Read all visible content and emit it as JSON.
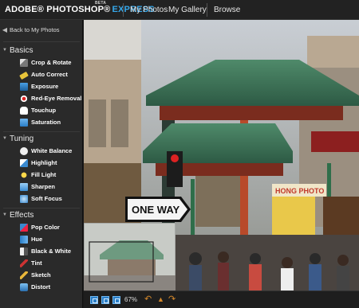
{
  "header": {
    "brand_adobe": "ADOBE® PHOTOSHOP®",
    "brand_express": "EXPRESS",
    "beta": "BETA",
    "nav": [
      "My Photos",
      "My Gallery",
      "Browse"
    ]
  },
  "sidebar": {
    "back_label": "Back to My Photos",
    "sections": [
      {
        "title": "Basics",
        "tools": [
          "Crop & Rotate",
          "Auto Correct",
          "Exposure",
          "Red-Eye Removal",
          "Touchup",
          "Saturation"
        ]
      },
      {
        "title": "Tuning",
        "tools": [
          "White Balance",
          "Highlight",
          "Fill Light",
          "Sharpen",
          "Soft Focus"
        ]
      },
      {
        "title": "Effects",
        "tools": [
          "Pop Color",
          "Hue",
          "Black & White",
          "Tint",
          "Sketch",
          "Distort"
        ]
      }
    ]
  },
  "photo": {
    "sign_text": "ONE WAY",
    "shop_text": "HONG PHOTO"
  },
  "bottom": {
    "zoom": "67%",
    "undo_icon": "undo-icon",
    "up_icon": "up-icon",
    "redo_icon": "redo-icon"
  },
  "colors": {
    "accent": "#36a7e9",
    "sidebar_bg": "#2a2a2a",
    "header_bg": "#222222"
  }
}
